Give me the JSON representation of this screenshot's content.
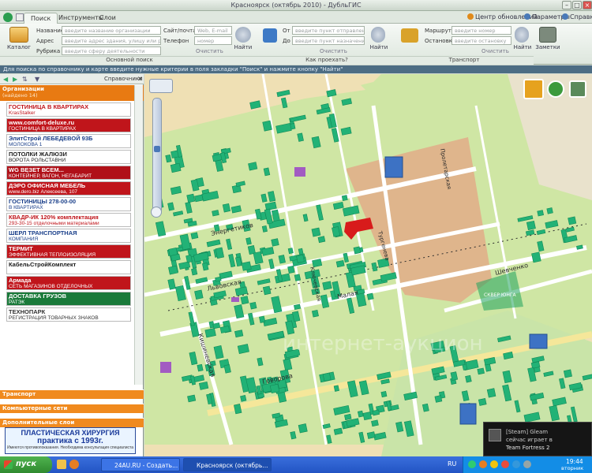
{
  "window": {
    "title": "Красноярск (октябрь 2010) - ДубльГИС"
  },
  "tabs": [
    "Поиск",
    "Инструменты",
    "Слои"
  ],
  "top_links": {
    "updates": "Центр обновлений",
    "params": "Параметры",
    "help": "Справка"
  },
  "ribbon": {
    "catalog_label": "Каталог",
    "name_label": "Название",
    "name_placeholder": "введите название организации",
    "address_label": "Адрес",
    "address_placeholder": "введите адрес здания, улицу или район",
    "rubric_label": "Рубрика",
    "rubric_placeholder": "введите сферу деятельности",
    "site_label": "Сайт/почта",
    "site_placeholder": "Web, E-mail",
    "phone_label": "Телефон",
    "phone_placeholder": "номер",
    "clear_label": "Очистить",
    "find_label": "Найти",
    "from_label": "От",
    "from_placeholder": "введите пункт отправления",
    "to_label": "До",
    "to_placeholder": "введите пункт назначения",
    "route_label": "Маршрут",
    "route_placeholder": "введите номер",
    "stop_label": "Остановка",
    "stop_placeholder": "введите остановку",
    "notes_label": "Заметки",
    "group_main": "Основной поиск",
    "group_how": "Как проехать?",
    "group_transport": "Транспорт"
  },
  "hint": "Для поиска по справочнику и карте введите нужные критерии в поля закладки \"Поиск\" и нажмите кнопку \"Найти\"",
  "left_panel": {
    "toolbar_label": "Справочники",
    "orgs_title": "Организации",
    "orgs_count": "(найдено 14)",
    "ads": [
      {
        "line1": "ГОСТИНИЦА В КВАРТИРАХ",
        "line2": "KrasStalker",
        "bg": "#ffffff",
        "fg": "#c0151b"
      },
      {
        "line1": "www.comfort-deluxe.ru",
        "line2": "ГОСТИНИЦА В КВАРТИРАХ",
        "bg": "#c0151b",
        "fg": "#ffffff"
      },
      {
        "line1": "ЭлитСтрой ЛЕБЕДЕВОЙ 93Б",
        "line2": "МОЛОКОВА 1",
        "bg": "#ffffff",
        "fg": "#1a3f8a"
      },
      {
        "line1": "ПОТОЛКИ ЖАЛЮЗИ",
        "line2": "ВОРОТА РОЛЬСТАВНИ",
        "bg": "#ffffff",
        "fg": "#222222"
      },
      {
        "line1": "WG ВЕЗЕТ ВСЕМ...",
        "line2": "КОНТЕЙНЕР, ВАГОН, НЕГАБАРИТ",
        "bg": "#b01018",
        "fg": "#ffffff"
      },
      {
        "line1": "ДЭРО ОФИСНАЯ МЕБЕЛЬ",
        "line2": "www.dero.biz Алексеева, 107",
        "bg": "#c0151b",
        "fg": "#ffffff"
      },
      {
        "line1": "ГОСТИНИЦЫ 278-00-00",
        "line2": "В КВАРТИРАХ",
        "bg": "#ffffff",
        "fg": "#1a3f8a"
      },
      {
        "line1": "КВАДР-ИК 120% комплектация",
        "line2": "293-30-15 отделочными материалами",
        "bg": "#ffffff",
        "fg": "#c0151b"
      },
      {
        "line1": "ШЕРЛ ТРАНСПОРТНАЯ",
        "line2": "КОМПАНИЯ",
        "bg": "#ffffff",
        "fg": "#1a3f8a"
      },
      {
        "line1": "ТЕРМИТ",
        "line2": "ЭФФЕКТИВНАЯ ТЕПЛОИЗОЛЯЦИЯ",
        "bg": "#c0151b",
        "fg": "#ffffff"
      },
      {
        "line1": "КабельСтройКомплект",
        "line2": "",
        "bg": "#ffffff",
        "fg": "#1a1a1a"
      },
      {
        "line1": "Армада",
        "line2": "СЕТЬ МАГАЗИНОВ ОТДЕЛОЧНЫХ МАТЕРИАЛОВ",
        "bg": "#c0151b",
        "fg": "#ffffff"
      },
      {
        "line1": "ДОСТАВКА ГРУЗОВ",
        "line2": "РАТЭК",
        "bg": "#1a7a3a",
        "fg": "#ffffff"
      },
      {
        "line1": "ТЕХНОПАРК",
        "line2": "РЕГИСТРАЦИЯ ТОВАРНЫХ ЗНАКОВ",
        "bg": "#ffffff",
        "fg": "#333333"
      }
    ],
    "transport": "Транспорт",
    "networks": "Компьютерные сети",
    "extra_layers": "Дополнительные слои",
    "bottom_ad_line1": "ПЛАСТИЧЕСКАЯ ХИРУРГИЯ",
    "bottom_ad_line2": "практика с 1993г.",
    "bottom_ad_line3": "Имеются противопоказания. Необходима консультация специалиста"
  },
  "map": {
    "streets": [
      "Энергетиков",
      "Львовская",
      "Кишиневская",
      "Малая",
      "Говорова",
      "Шевченко",
      "Тургенева",
      "Ключевская",
      "Пролетарская"
    ],
    "square_label": "СКВЕР ЮНГА",
    "watermark": "интернет-аукцион",
    "bg_land": "#efe0b4",
    "bg_residential": "#cfe6a4",
    "bg_industrial": "#dfb58c",
    "building_color": "#22b276",
    "highlight_color": "#d81b1b",
    "purple_color": "#a25bc2",
    "blue_color": "#3d72c4"
  },
  "notification": {
    "line1": "[Steam] Gleam",
    "line2": "сейчас играет в",
    "line3": "Team Fortress 2"
  },
  "taskbar": {
    "start": "пуск",
    "items": [
      "24AU.RU - Создать...",
      "Красноярск (октябрь..."
    ],
    "lang": "RU",
    "time": "19:44",
    "day": "вторник"
  }
}
